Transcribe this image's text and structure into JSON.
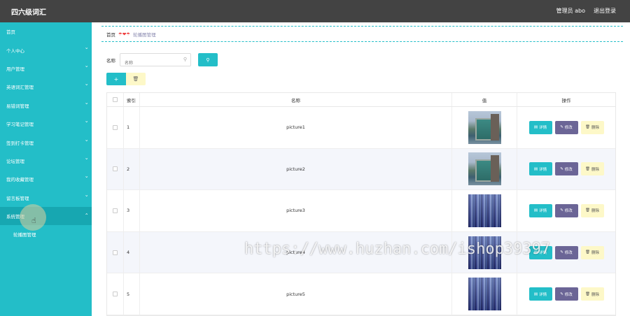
{
  "app": {
    "title": "四六级词汇"
  },
  "topbar": {
    "admin_label": "管理员 abo",
    "logout_label": "退出登录"
  },
  "sidebar": {
    "items": [
      {
        "label": "首页",
        "has_chevron": false
      },
      {
        "label": "个人中心",
        "has_chevron": true
      },
      {
        "label": "用户管理",
        "has_chevron": true
      },
      {
        "label": "英语词汇管理",
        "has_chevron": true
      },
      {
        "label": "易错词管理",
        "has_chevron": true
      },
      {
        "label": "学习笔记管理",
        "has_chevron": true
      },
      {
        "label": "签到打卡管理",
        "has_chevron": true
      },
      {
        "label": "论坛管理",
        "has_chevron": true
      },
      {
        "label": "我的收藏管理",
        "has_chevron": true
      },
      {
        "label": "留言板管理",
        "has_chevron": true
      },
      {
        "label": "系统管理",
        "has_chevron": true,
        "expanded": true
      }
    ],
    "subitems": [
      {
        "label": "轮播图管理"
      }
    ]
  },
  "breadcrumb": {
    "home": "首页",
    "brand": "☂❤☂",
    "current": "轮播图管理"
  },
  "search": {
    "label": "名称",
    "placeholder": "名称",
    "button_icon": "search-icon"
  },
  "actions": {
    "add_label": "+",
    "delete_icon": "trash-icon"
  },
  "table": {
    "headers": {
      "index": "索引",
      "name": "名称",
      "value": "值",
      "ops": "操作"
    },
    "rows": [
      {
        "index": "1",
        "name": "picture1",
        "image": "thumb-a"
      },
      {
        "index": "2",
        "name": "picture2",
        "image": "thumb-a"
      },
      {
        "index": "3",
        "name": "picture3",
        "image": "thumb-b"
      },
      {
        "index": "4",
        "name": "picture4",
        "image": "thumb-b"
      },
      {
        "index": "5",
        "name": "picture5",
        "image": "thumb-b"
      }
    ],
    "ops_labels": {
      "detail": "详情",
      "edit": "修改",
      "delete": "删除"
    }
  },
  "watermark": "https://www.huzhan.com/ishop39397",
  "colors": {
    "accent": "#23bec8",
    "topbar": "#434343",
    "edit": "#6b6596",
    "delete": "#fdf8c8"
  }
}
